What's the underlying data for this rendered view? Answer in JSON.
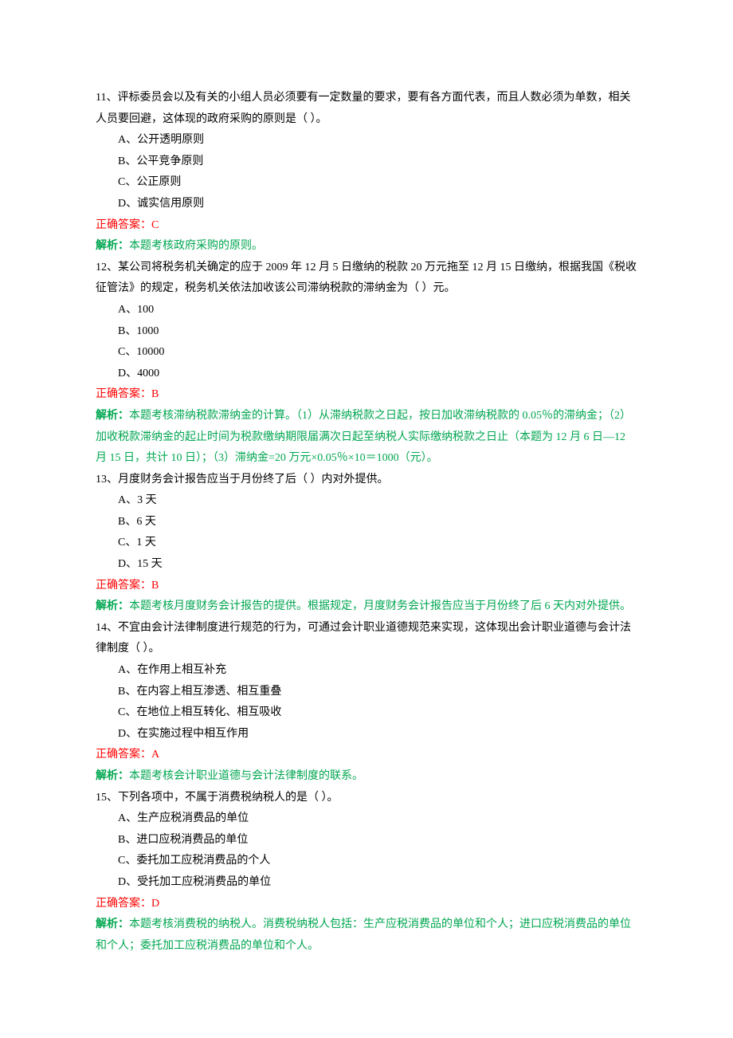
{
  "questions": [
    {
      "stem": "11、评标委员会以及有关的小组人员必须要有一定数量的要求，要有各方面代表，而且人数必须为单数，相关人员要回避，这体现的政府采购的原则是（ ）。",
      "options": [
        "A、公开透明原则",
        "B、公平竞争原则",
        "C、公正原则",
        "D、诚实信用原则"
      ],
      "answer": "正确答案：C",
      "analysis_label": "解析：",
      "analysis_text": "本题考核政府采购的原则。"
    },
    {
      "stem": "12、某公司将税务机关确定的应于 2009 年 12 月 5 日缴纳的税款 20 万元拖至 12 月 15 日缴纳，根据我国《税收征管法》的规定，税务机关依法加收该公司滞纳税款的滞纳金为（ ）元。",
      "options": [
        "A、100",
        "B、1000",
        "C、10000",
        "D、4000"
      ],
      "answer": "正确答案：B",
      "analysis_label": "解析：",
      "analysis_text": "本题考核滞纳税款滞纳金的计算。（1）从滞纳税款之日起，按日加收滞纳税款的 0.05％的滞纳金；（2）加收税款滞纳金的起止时间为税款缴纳期限届满次日起至纳税人实际缴纳税款之日止（本题为 12 月 6 日—12 月 15 日，共计 10 日）；（3）滞纳金=20 万元×0.05％×10＝1000（元）。"
    },
    {
      "stem": "13、月度财务会计报告应当于月份终了后（ ）内对外提供。",
      "options": [
        "A、3 天",
        "B、6 天",
        "C、1 天",
        "D、15 天"
      ],
      "answer": "正确答案：B",
      "analysis_label": "解析：",
      "analysis_text": "本题考核月度财务会计报告的提供。根据规定，月度财务会计报告应当于月份终了后 6 天内对外提供。"
    },
    {
      "stem": "14、不宜由会计法律制度进行规范的行为，可通过会计职业道德规范来实现，这体现出会计职业道德与会计法律制度（ ）。",
      "options": [
        "A、在作用上相互补充",
        "B、在内容上相互渗透、相互重叠",
        "C、在地位上相互转化、相互吸收",
        "D、在实施过程中相互作用"
      ],
      "answer": "正确答案：A",
      "analysis_label": "解析：",
      "analysis_text": "本题考核会计职业道德与会计法律制度的联系。"
    },
    {
      "stem": "15、下列各项中，不属于消费税纳税人的是（ ）。",
      "options": [
        "A、生产应税消费品的单位",
        "B、进口应税消费品的单位",
        "C、委托加工应税消费品的个人",
        "D、受托加工应税消费品的单位"
      ],
      "answer": "正确答案：D",
      "analysis_label": "解析：",
      "analysis_text": "本题考核消费税的纳税人。消费税纳税人包括：生产应税消费品的单位和个人；进口应税消费品的单位和个人；委托加工应税消费品的单位和个人。"
    }
  ]
}
